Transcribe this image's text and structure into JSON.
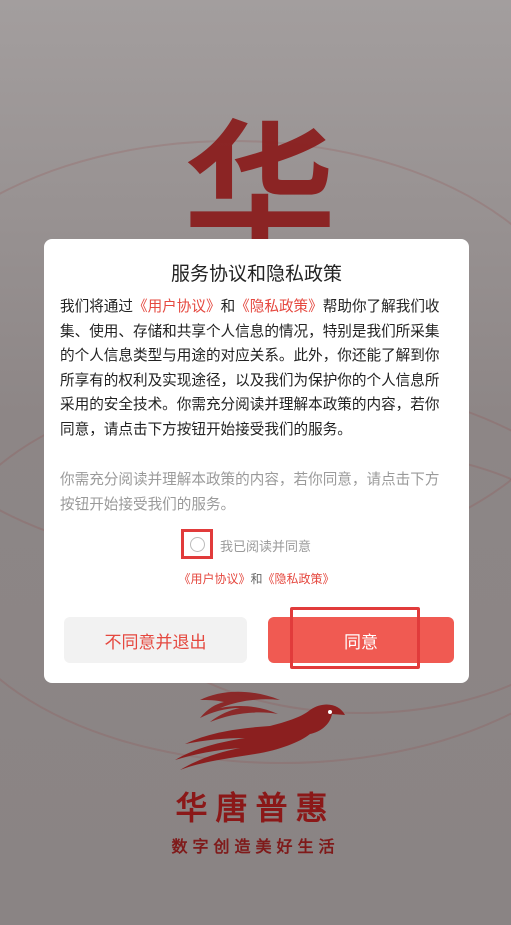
{
  "background": {
    "glyph": "华",
    "brand_name": "华唐普惠",
    "slogan": "数字创造美好生活",
    "logo_icon": "eagle-icon"
  },
  "dialog": {
    "title": "服务协议和隐私政策",
    "body": {
      "part1": "我们将通过",
      "link_user": "《用户协议》",
      "part2": "和",
      "link_privacy": "《隐私政策》",
      "part3": "帮助你了解我们收集、使用、存储和共享个人信息的情况，特别是我们所采集的个人信息类型与用途的对应关系。此外，你还能了解到你所享有的权利及实现途径，以及我们为保护你的个人信息所采用的安全技术。你需充分阅读并理解本政策的内容，若你同意，请点击下方按钮开始接受我们的服务。"
    },
    "hint": "你需充分阅读并理解本政策的内容，若你同意，请点击下方按钮开始接受我们的服务。",
    "checkbox_label": "我已阅读并同意",
    "links": {
      "user": "《用户协议》",
      "and": "和",
      "privacy": "《隐私政策》"
    },
    "buttons": {
      "decline": "不同意并退出",
      "agree": "同意"
    }
  },
  "colors": {
    "accent": "#f05a52",
    "link": "#e5483f",
    "brand": "#8b1818"
  }
}
